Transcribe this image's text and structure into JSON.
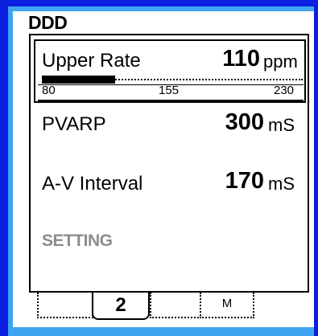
{
  "mode": "DDD",
  "upper_rate": {
    "label": "Upper Rate",
    "value": "110",
    "unit": "ppm",
    "scale_min": "80",
    "scale_mid": "155",
    "scale_max": "230",
    "fill_fraction": 0.28
  },
  "pvarp": {
    "label": "PVARP",
    "value": "300",
    "unit": "mS"
  },
  "av_interval": {
    "label": "A-V Interval",
    "value": "170",
    "unit": "mS"
  },
  "setting_label": "SETTING",
  "tabs": {
    "active_label": "2",
    "menu_label": "M"
  }
}
